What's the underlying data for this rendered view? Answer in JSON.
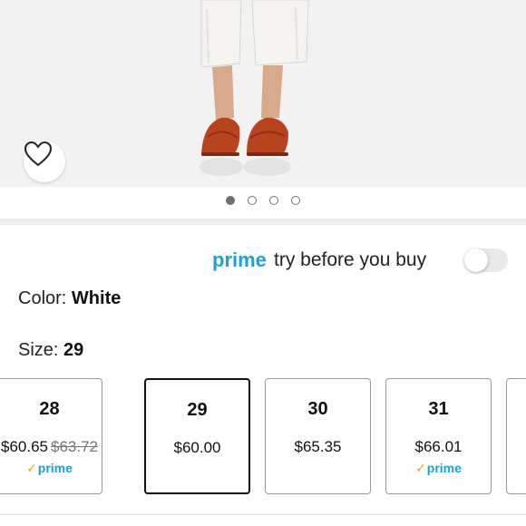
{
  "product_image": {
    "icon": "product-photo-white-pants-red-sandals"
  },
  "wishlist": {
    "icon": "heart-outline-icon"
  },
  "carousel": {
    "count": 4,
    "active_index": 0
  },
  "prime_try": {
    "prime_label": "prime",
    "text": "try before you buy",
    "toggle_on": false
  },
  "color": {
    "label": "Color:",
    "value": "White"
  },
  "size": {
    "label": "Size:",
    "value": "29"
  },
  "sizes": [
    {
      "size": "28",
      "price": "$60.65",
      "list_price": "$63.72",
      "prime": "prime",
      "selected": false
    },
    {
      "size": "29",
      "price": "$60.00",
      "list_price": "",
      "prime": "",
      "selected": true
    },
    {
      "size": "30",
      "price": "$65.35",
      "list_price": "",
      "prime": "",
      "selected": false
    },
    {
      "size": "31",
      "price": "$66.01",
      "list_price": "",
      "prime": "prime",
      "selected": false
    }
  ],
  "colors": {
    "prime_blue": "#1aa2d8",
    "check_orange": "#f0a018",
    "shoe": "#b7431f"
  }
}
